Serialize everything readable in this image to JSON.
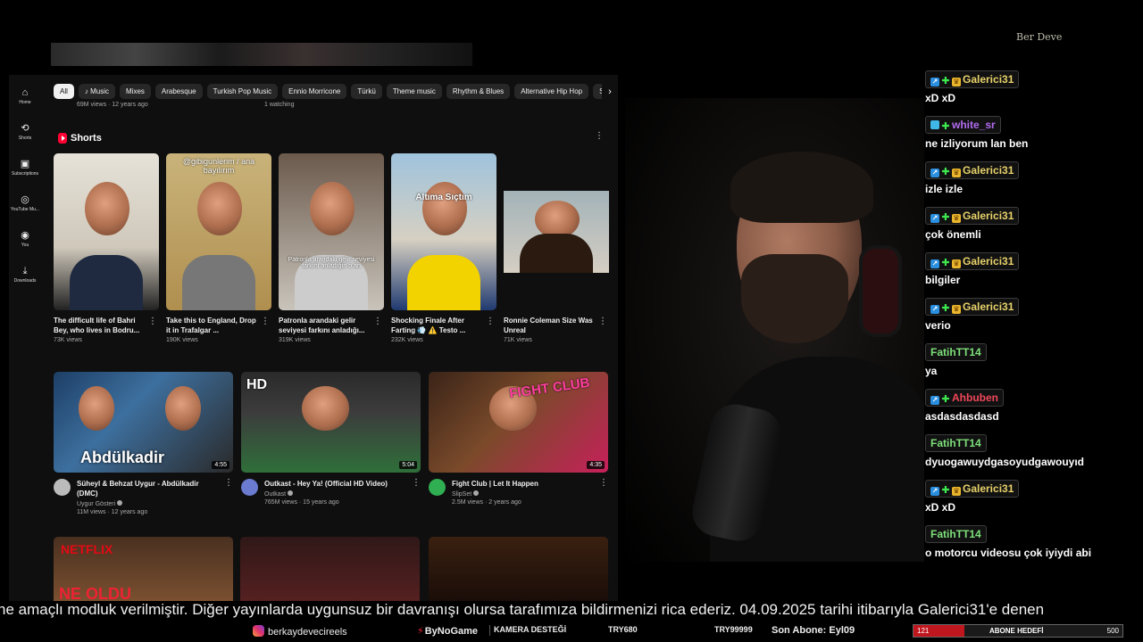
{
  "youtube": {
    "sidebar": [
      {
        "label": "Home",
        "icon": "home-icon",
        "glyph": "⌂"
      },
      {
        "label": "Shorts",
        "icon": "shorts-icon",
        "glyph": "⟲"
      },
      {
        "label": "Subscriptions",
        "icon": "subscriptions-icon",
        "glyph": "▣"
      },
      {
        "label": "YouTube Mu...",
        "icon": "music-icon",
        "glyph": "◎"
      },
      {
        "label": "You",
        "icon": "user-icon",
        "glyph": "◉"
      },
      {
        "label": "Downloads",
        "icon": "download-icon",
        "glyph": "⤓"
      }
    ],
    "chips": [
      "All",
      "♪ Music",
      "Mixes",
      "Arabesque",
      "Turkish Pop Music",
      "Ennio Morricone",
      "Türkü",
      "Theme music",
      "Rhythm & Blues",
      "Alternative Hip Hop",
      "So"
    ],
    "peek_left": "69M views · 12 years ago",
    "peek_right": "1 watching",
    "shorts_label": "Shorts",
    "shorts": [
      {
        "title": "The difficult life of Bahri Bey, who lives in Bodru...",
        "views": "73K views",
        "caption": ""
      },
      {
        "title": "Take this to England, Drop it in Trafalgar ...",
        "views": "190K views",
        "caption": "@gibigunlerim / ana bayılırım"
      },
      {
        "title": "Patronla arandaki gelir seviyesi farkını anladığı...",
        "views": "319K views",
        "caption": "Patronla arandaki gelir seviyesi farkını anladığın o an"
      },
      {
        "title": "Shocking Finale After Farting 💨 ⚠️ Testo ...",
        "views": "232K views",
        "caption": "Altıma Sıçtım"
      },
      {
        "title": "Ronnie Coleman Size Was Unreal",
        "views": "71K views",
        "caption": ""
      }
    ],
    "videos": [
      {
        "title": "Süheyl & Behzat Uygur - Abdülkadir (DMC)",
        "channel": "Uygur Gösteri",
        "stats": "11M views · 12 years ago",
        "duration": "4:55",
        "overlay": "Abdülkadir"
      },
      {
        "title": "Outkast - Hey Ya! (Official HD Video)",
        "channel": "Outkast",
        "stats": "765M views · 15 years ago",
        "duration": "5:04",
        "overlay": "HD"
      },
      {
        "title": "Fight Club | Let It Happen",
        "channel": "SlipSet",
        "stats": "2.5M views · 2 years ago",
        "duration": "4:35",
        "overlay": "FIGHT CLUB"
      }
    ],
    "bottom_row_overlay": [
      "NETFLIX",
      "NE OLDU",
      ""
    ]
  },
  "streamer_logo": "Ber Deve",
  "chat": [
    {
      "user": "Galerici31",
      "color": "#e8d26a",
      "badges": [
        "b",
        "g",
        "y"
      ],
      "text": "xD xD"
    },
    {
      "user": "white_sr",
      "color": "#b26cf0",
      "badges": [
        "c",
        "g"
      ],
      "text": "ne izliyorum lan ben"
    },
    {
      "user": "Galerici31",
      "color": "#e8d26a",
      "badges": [
        "b",
        "g",
        "y"
      ],
      "text": "izle izle"
    },
    {
      "user": "Galerici31",
      "color": "#e8d26a",
      "badges": [
        "b",
        "g",
        "y"
      ],
      "text": "çok önemli"
    },
    {
      "user": "Galerici31",
      "color": "#e8d26a",
      "badges": [
        "b",
        "g",
        "y"
      ],
      "text": "bilgiler"
    },
    {
      "user": "Galerici31",
      "color": "#e8d26a",
      "badges": [
        "b",
        "g",
        "y"
      ],
      "text": "verio"
    },
    {
      "user": "FatihTT14",
      "color": "#7ee07a",
      "badges": [],
      "text": "ya"
    },
    {
      "user": "Ahbuben",
      "color": "#f0475a",
      "badges": [
        "b",
        "g"
      ],
      "text": "asdasdasdasd"
    },
    {
      "user": "FatihTT14",
      "color": "#7ee07a",
      "badges": [],
      "text": "dyuogawuydgasoyudgawouyıd"
    },
    {
      "user": "Galerici31",
      "color": "#e8d26a",
      "badges": [
        "b",
        "g",
        "y"
      ],
      "text": "xD xD"
    },
    {
      "user": "FatihTT14",
      "color": "#7ee07a",
      "badges": [],
      "text": "o motorcu videosu çok iyiydi abi"
    }
  ],
  "ticker": "ne amaçlı modluk verilmiştir. Diğer yayınlarda uygunsuz bir davranışı olursa tarafımıza bildirmenizi rica ederiz. 04.09.2025 tarihi itibarıyla Galerici31'e denen",
  "footer": {
    "instagram": "berkaydevecireels",
    "sponsor": "ByNoGame",
    "kamera": "KAMERA DESTEĞİ",
    "try1": "TRY680",
    "try2": "TRY99999",
    "last_sub": "Son Abone: Eyl09",
    "goal_current": "121",
    "goal_label": "ABONE HEDEFİ",
    "goal_target": "500",
    "goal_fraction": 0.242
  },
  "colors": {
    "youtube_bg": "#0f0f0f",
    "goal_fill": "#c0171e",
    "shorts_red": "#ff0033"
  }
}
